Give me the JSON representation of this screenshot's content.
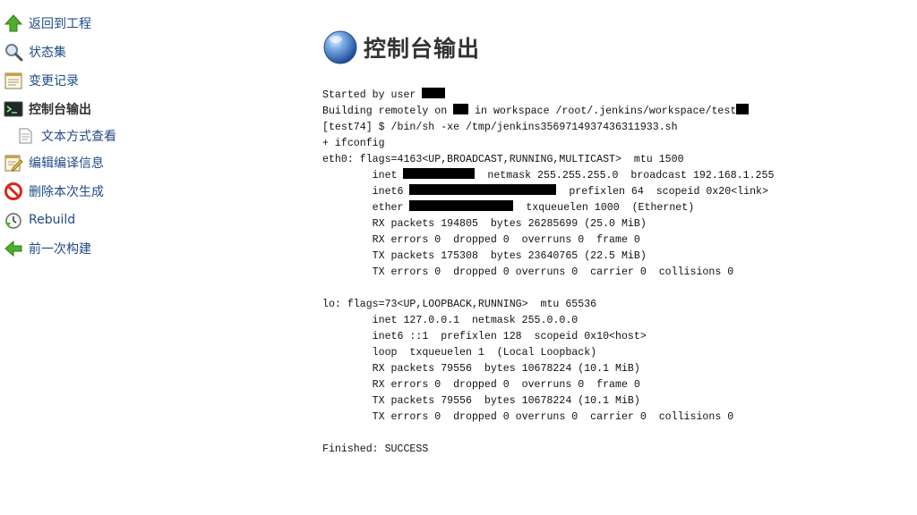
{
  "sidebar": {
    "items": [
      {
        "label": "返回到工程",
        "icon": "up-arrow-icon"
      },
      {
        "label": "状态集",
        "icon": "magnifier-icon"
      },
      {
        "label": "变更记录",
        "icon": "notepad-icon"
      },
      {
        "label": "控制台输出",
        "icon": "terminal-icon",
        "active": true
      },
      {
        "label": "文本方式查看",
        "icon": "document-icon",
        "sub": true
      },
      {
        "label": "编辑编译信息",
        "icon": "notepad-pencil-icon"
      },
      {
        "label": "删除本次生成",
        "icon": "no-entry-icon"
      },
      {
        "label": "Rebuild",
        "icon": "clock-arrow-icon"
      },
      {
        "label": "前一次构建",
        "icon": "left-arrow-icon"
      }
    ]
  },
  "main": {
    "title": "控制台输出"
  },
  "console": {
    "started_prefix": "Started by user ",
    "building_prefix": "Building remotely on ",
    "building_mid": " in workspace /root/.jenkins/workspace/test",
    "command": "[test74] $ /bin/sh -xe /tmp/jenkins3569714937436311933.sh",
    "ifconfig": "+ ifconfig",
    "eth0_header": "eth0: flags=4163<UP,BROADCAST,RUNNING,MULTICAST>  mtu 1500",
    "eth0_inet_prefix": "        inet ",
    "eth0_inet_suffix": "  netmask 255.255.255.0  broadcast 192.168.1.255",
    "eth0_inet6_prefix": "        inet6 ",
    "eth0_inet6_suffix": "  prefixlen 64  scopeid 0x20<link>",
    "eth0_ether_prefix": "        ether ",
    "eth0_ether_suffix": "  txqueuelen 1000  (Ethernet)",
    "eth0_rx_packets": "        RX packets 194805  bytes 26285699 (25.0 MiB)",
    "eth0_rx_errors": "        RX errors 0  dropped 0  overruns 0  frame 0",
    "eth0_tx_packets": "        TX packets 175308  bytes 23640765 (22.5 MiB)",
    "eth0_tx_errors": "        TX errors 0  dropped 0 overruns 0  carrier 0  collisions 0",
    "lo_header": "lo: flags=73<UP,LOOPBACK,RUNNING>  mtu 65536",
    "lo_inet": "        inet 127.0.0.1  netmask 255.0.0.0",
    "lo_inet6": "        inet6 ::1  prefixlen 128  scopeid 0x10<host>",
    "lo_loop": "        loop  txqueuelen 1  (Local Loopback)",
    "lo_rx_packets": "        RX packets 79556  bytes 10678224 (10.1 MiB)",
    "lo_rx_errors": "        RX errors 0  dropped 0  overruns 0  frame 0",
    "lo_tx_packets": "        TX packets 79556  bytes 10678224 (10.1 MiB)",
    "lo_tx_errors": "        TX errors 0  dropped 0 overruns 0  carrier 0  collisions 0",
    "finished": "Finished: SUCCESS"
  }
}
